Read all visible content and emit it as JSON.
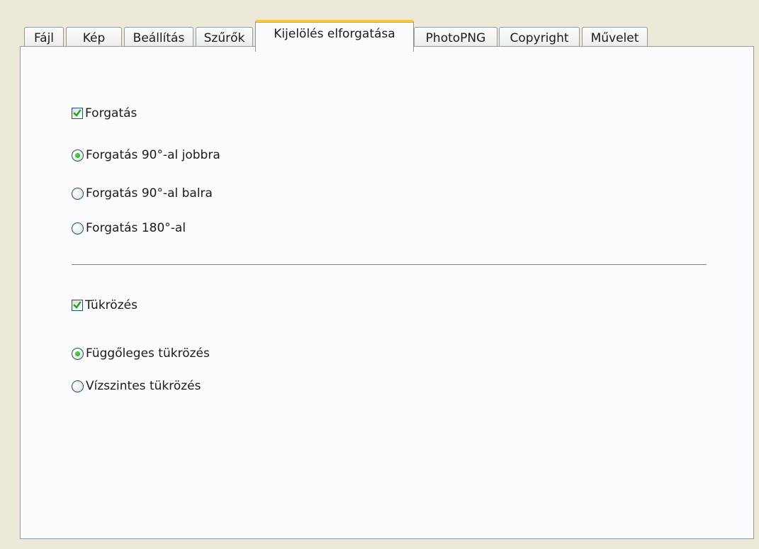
{
  "tabs": [
    {
      "label": "Fájl",
      "active": false
    },
    {
      "label": "Kép",
      "active": false
    },
    {
      "label": "Beállítás",
      "active": false
    },
    {
      "label": "Szűrők",
      "active": false
    },
    {
      "label": "Kijelölés elforgatása",
      "active": true
    },
    {
      "label": "PhotoPNG",
      "active": false
    },
    {
      "label": "Copyright",
      "active": false
    },
    {
      "label": "Művelet",
      "active": false
    }
  ],
  "rotation": {
    "checkbox_label": "Forgatás",
    "checked": true,
    "options": [
      {
        "label": "Forgatás 90°-al jobbra",
        "selected": true
      },
      {
        "label": "Forgatás 90°-al balra",
        "selected": false
      },
      {
        "label": "Forgatás 180°-al",
        "selected": false
      }
    ]
  },
  "mirror": {
    "checkbox_label": "Tükrözés",
    "checked": true,
    "options": [
      {
        "label": "Függőleges tükrözés",
        "selected": true
      },
      {
        "label": "Vízszintes tükrözés",
        "selected": false
      }
    ]
  },
  "colors": {
    "active_tab_accent": "#ffc83c",
    "check_mark": "#21a121",
    "control_border": "#1c5180"
  }
}
